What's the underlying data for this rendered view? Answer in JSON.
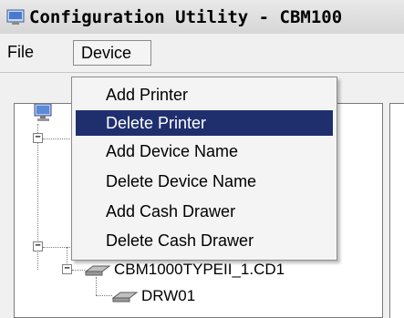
{
  "window": {
    "title": "Configuration Utility - CBM100"
  },
  "menubar": {
    "file": "File",
    "device": "Device"
  },
  "device_menu": {
    "items": [
      {
        "label": "Add Printer",
        "selected": false
      },
      {
        "label": "Delete Printer",
        "selected": true
      },
      {
        "label": "Add Device Name",
        "selected": false
      },
      {
        "label": "Delete Device Name",
        "selected": false
      },
      {
        "label": "Add Cash Drawer",
        "selected": false
      },
      {
        "label": "Delete Cash Drawer",
        "selected": false
      }
    ]
  },
  "tree": {
    "cash_drawer_node": "CBM1000TYPEII_1.CD1",
    "drawer_child": "DRW01",
    "expander_symbol": "−"
  },
  "colors": {
    "selection": "#1f2f6e",
    "menu_bg": "#f4f4f4",
    "window_bg": "#f0f0f0"
  }
}
